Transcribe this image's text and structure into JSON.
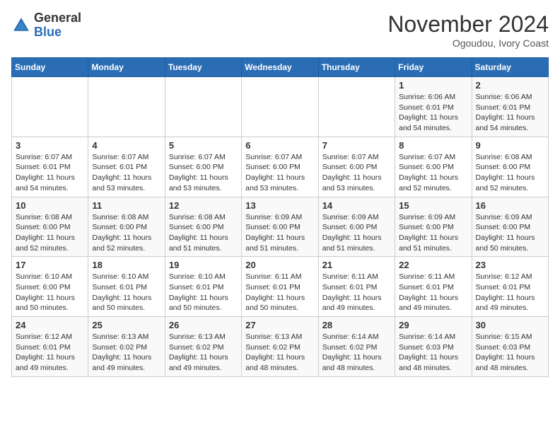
{
  "header": {
    "logo_line1": "General",
    "logo_line2": "Blue",
    "month": "November 2024",
    "location": "Ogoudou, Ivory Coast"
  },
  "weekdays": [
    "Sunday",
    "Monday",
    "Tuesday",
    "Wednesday",
    "Thursday",
    "Friday",
    "Saturday"
  ],
  "weeks": [
    [
      {
        "day": "",
        "info": ""
      },
      {
        "day": "",
        "info": ""
      },
      {
        "day": "",
        "info": ""
      },
      {
        "day": "",
        "info": ""
      },
      {
        "day": "",
        "info": ""
      },
      {
        "day": "1",
        "info": "Sunrise: 6:06 AM\nSunset: 6:01 PM\nDaylight: 11 hours\nand 54 minutes."
      },
      {
        "day": "2",
        "info": "Sunrise: 6:06 AM\nSunset: 6:01 PM\nDaylight: 11 hours\nand 54 minutes."
      }
    ],
    [
      {
        "day": "3",
        "info": "Sunrise: 6:07 AM\nSunset: 6:01 PM\nDaylight: 11 hours\nand 54 minutes."
      },
      {
        "day": "4",
        "info": "Sunrise: 6:07 AM\nSunset: 6:01 PM\nDaylight: 11 hours\nand 53 minutes."
      },
      {
        "day": "5",
        "info": "Sunrise: 6:07 AM\nSunset: 6:00 PM\nDaylight: 11 hours\nand 53 minutes."
      },
      {
        "day": "6",
        "info": "Sunrise: 6:07 AM\nSunset: 6:00 PM\nDaylight: 11 hours\nand 53 minutes."
      },
      {
        "day": "7",
        "info": "Sunrise: 6:07 AM\nSunset: 6:00 PM\nDaylight: 11 hours\nand 53 minutes."
      },
      {
        "day": "8",
        "info": "Sunrise: 6:07 AM\nSunset: 6:00 PM\nDaylight: 11 hours\nand 52 minutes."
      },
      {
        "day": "9",
        "info": "Sunrise: 6:08 AM\nSunset: 6:00 PM\nDaylight: 11 hours\nand 52 minutes."
      }
    ],
    [
      {
        "day": "10",
        "info": "Sunrise: 6:08 AM\nSunset: 6:00 PM\nDaylight: 11 hours\nand 52 minutes."
      },
      {
        "day": "11",
        "info": "Sunrise: 6:08 AM\nSunset: 6:00 PM\nDaylight: 11 hours\nand 52 minutes."
      },
      {
        "day": "12",
        "info": "Sunrise: 6:08 AM\nSunset: 6:00 PM\nDaylight: 11 hours\nand 51 minutes."
      },
      {
        "day": "13",
        "info": "Sunrise: 6:09 AM\nSunset: 6:00 PM\nDaylight: 11 hours\nand 51 minutes."
      },
      {
        "day": "14",
        "info": "Sunrise: 6:09 AM\nSunset: 6:00 PM\nDaylight: 11 hours\nand 51 minutes."
      },
      {
        "day": "15",
        "info": "Sunrise: 6:09 AM\nSunset: 6:00 PM\nDaylight: 11 hours\nand 51 minutes."
      },
      {
        "day": "16",
        "info": "Sunrise: 6:09 AM\nSunset: 6:00 PM\nDaylight: 11 hours\nand 50 minutes."
      }
    ],
    [
      {
        "day": "17",
        "info": "Sunrise: 6:10 AM\nSunset: 6:00 PM\nDaylight: 11 hours\nand 50 minutes."
      },
      {
        "day": "18",
        "info": "Sunrise: 6:10 AM\nSunset: 6:01 PM\nDaylight: 11 hours\nand 50 minutes."
      },
      {
        "day": "19",
        "info": "Sunrise: 6:10 AM\nSunset: 6:01 PM\nDaylight: 11 hours\nand 50 minutes."
      },
      {
        "day": "20",
        "info": "Sunrise: 6:11 AM\nSunset: 6:01 PM\nDaylight: 11 hours\nand 50 minutes."
      },
      {
        "day": "21",
        "info": "Sunrise: 6:11 AM\nSunset: 6:01 PM\nDaylight: 11 hours\nand 49 minutes."
      },
      {
        "day": "22",
        "info": "Sunrise: 6:11 AM\nSunset: 6:01 PM\nDaylight: 11 hours\nand 49 minutes."
      },
      {
        "day": "23",
        "info": "Sunrise: 6:12 AM\nSunset: 6:01 PM\nDaylight: 11 hours\nand 49 minutes."
      }
    ],
    [
      {
        "day": "24",
        "info": "Sunrise: 6:12 AM\nSunset: 6:01 PM\nDaylight: 11 hours\nand 49 minutes."
      },
      {
        "day": "25",
        "info": "Sunrise: 6:13 AM\nSunset: 6:02 PM\nDaylight: 11 hours\nand 49 minutes."
      },
      {
        "day": "26",
        "info": "Sunrise: 6:13 AM\nSunset: 6:02 PM\nDaylight: 11 hours\nand 49 minutes."
      },
      {
        "day": "27",
        "info": "Sunrise: 6:13 AM\nSunset: 6:02 PM\nDaylight: 11 hours\nand 48 minutes."
      },
      {
        "day": "28",
        "info": "Sunrise: 6:14 AM\nSunset: 6:02 PM\nDaylight: 11 hours\nand 48 minutes."
      },
      {
        "day": "29",
        "info": "Sunrise: 6:14 AM\nSunset: 6:03 PM\nDaylight: 11 hours\nand 48 minutes."
      },
      {
        "day": "30",
        "info": "Sunrise: 6:15 AM\nSunset: 6:03 PM\nDaylight: 11 hours\nand 48 minutes."
      }
    ]
  ]
}
